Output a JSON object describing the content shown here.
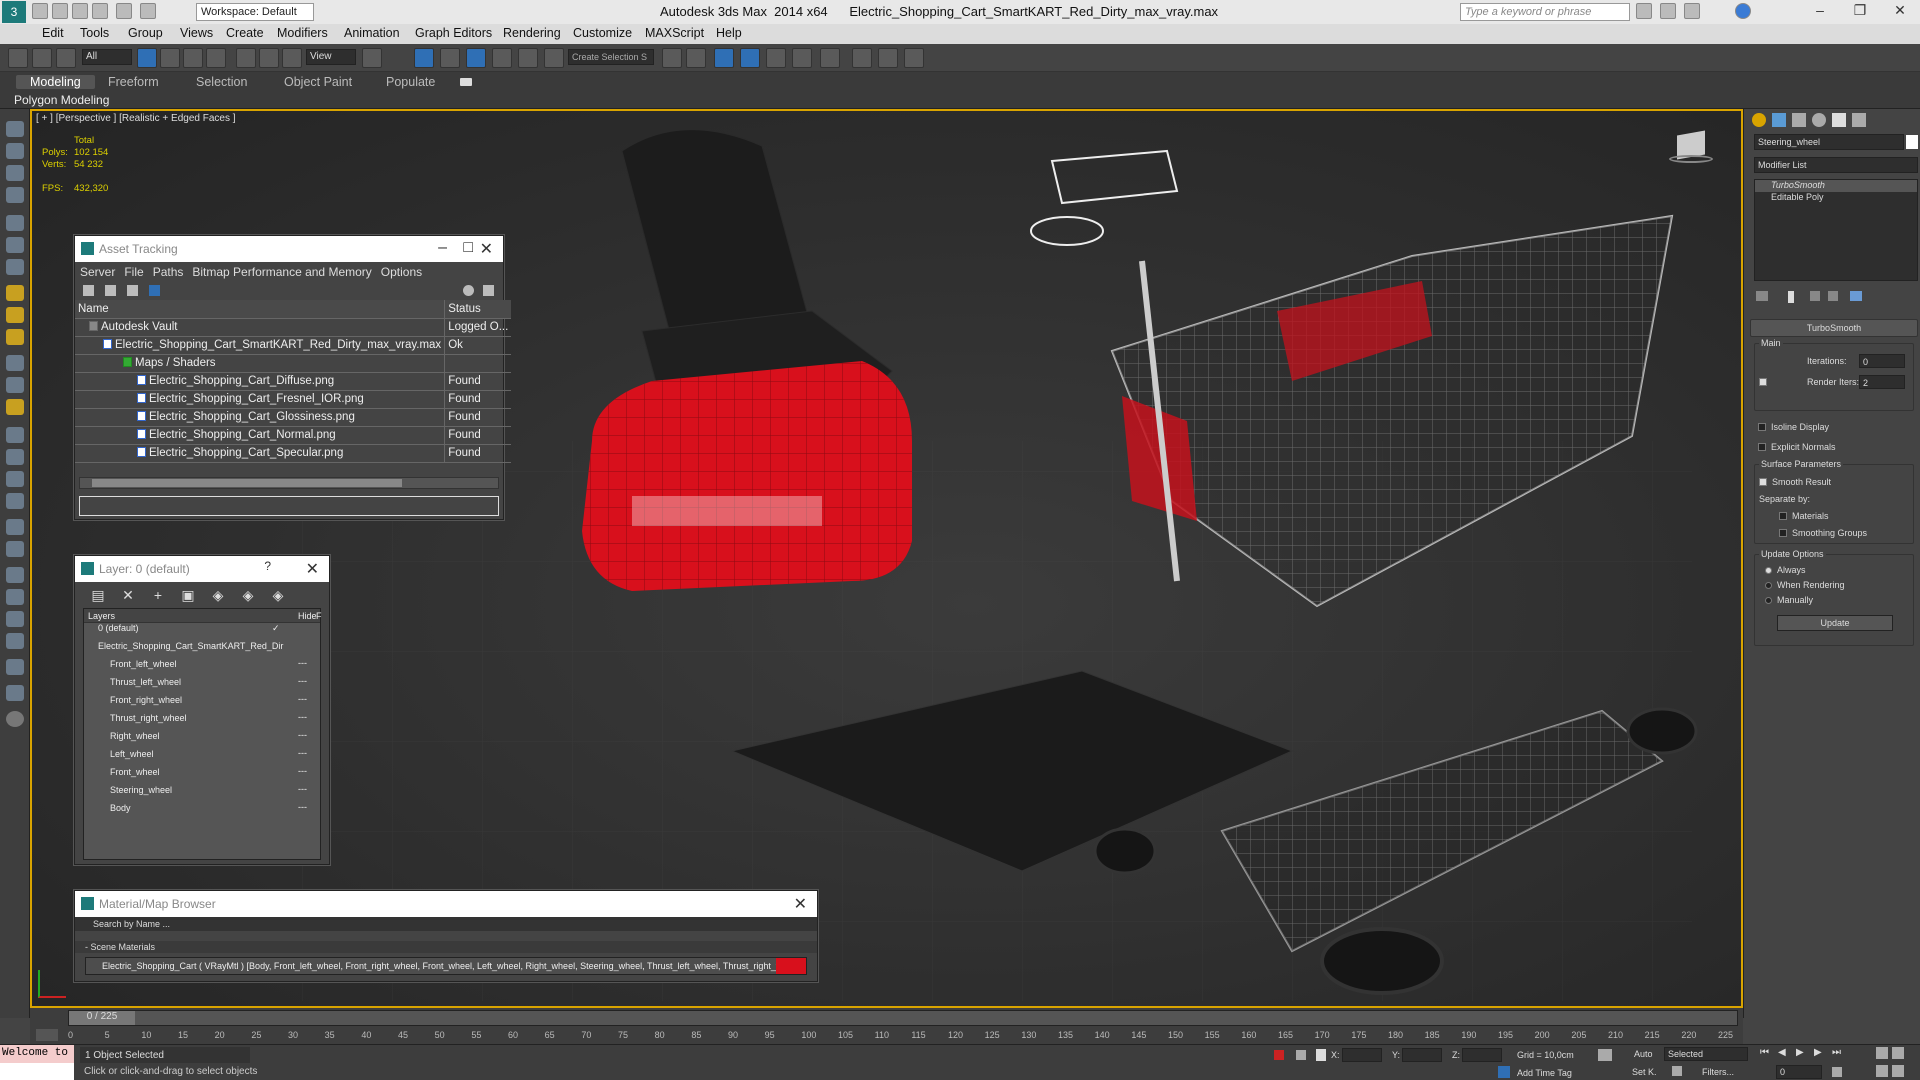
{
  "app": {
    "title": "Autodesk 3ds Max  2014 x64      Electric_Shopping_Cart_SmartKART_Red_Dirty_max_vray.max",
    "workspace": "Workspace: Default",
    "search_placeholder": "Type a keyword or phrase"
  },
  "menu": [
    "Edit",
    "Tools",
    "Group",
    "Views",
    "Create",
    "Modifiers",
    "Animation",
    "Graph Editors",
    "Rendering",
    "Customize",
    "MAXScript",
    "Help"
  ],
  "toolbar": {
    "selection_filter": "All",
    "view_mode": "View",
    "named_selection": "Create Selection S"
  },
  "ribbon": {
    "tabs": [
      "Modeling",
      "Freeform",
      "Selection",
      "Object Paint",
      "Populate"
    ],
    "subtab": "Polygon Modeling"
  },
  "viewport": {
    "label": "[ + ] [Perspective ] [Realistic + Edged Faces ]",
    "stats": {
      "total_label": "Total",
      "polys_label": "Polys:",
      "polys": "102 154",
      "verts_label": "Verts:",
      "verts": "54 232",
      "fps_label": "FPS:",
      "fps": "432,320"
    }
  },
  "asset_tracking": {
    "title": "Asset Tracking",
    "menu": [
      "Server",
      "File",
      "Paths",
      "Bitmap Performance and Memory",
      "Options"
    ],
    "columns": [
      "Name",
      "Status"
    ],
    "rows": [
      {
        "name": "Autodesk Vault",
        "status": "Logged O..."
      },
      {
        "name": "Electric_Shopping_Cart_SmartKART_Red_Dirty_max_vray.max",
        "status": "Ok"
      },
      {
        "name": "Maps / Shaders",
        "status": ""
      },
      {
        "name": "Electric_Shopping_Cart_Diffuse.png",
        "status": "Found"
      },
      {
        "name": "Electric_Shopping_Cart_Fresnel_IOR.png",
        "status": "Found"
      },
      {
        "name": "Electric_Shopping_Cart_Glossiness.png",
        "status": "Found"
      },
      {
        "name": "Electric_Shopping_Cart_Normal.png",
        "status": "Found"
      },
      {
        "name": "Electric_Shopping_Cart_Specular.png",
        "status": "Found"
      }
    ]
  },
  "layer": {
    "title": "Layer: 0 (default)",
    "help": "?",
    "columns": [
      "Layers",
      "Hide",
      "Fr"
    ],
    "items": [
      "0 (default)",
      "Electric_Shopping_Cart_SmartKART_Red_Dir",
      "Front_left_wheel",
      "Thrust_left_wheel",
      "Front_right_wheel",
      "Thrust_right_wheel",
      "Right_wheel",
      "Left_wheel",
      "Front_wheel",
      "Steering_wheel",
      "Body"
    ],
    "hide_mark": "---"
  },
  "material_browser": {
    "title": "Material/Map Browser",
    "search": "Search by Name ...",
    "section": "- Scene Materials",
    "item": "Electric_Shopping_Cart  ( VRayMtl ) [Body, Front_left_wheel, Front_right_wheel, Front_wheel, Left_wheel, Right_wheel, Steering_wheel, Thrust_left_wheel, Thrust_right_wheel]"
  },
  "command_panel": {
    "object_name": "Steering_wheel",
    "modifier_list": "Modifier List",
    "stack": [
      "TurboSmooth",
      "Editable Poly"
    ],
    "rollout": "TurboSmooth",
    "main": "Main",
    "iterations_label": "Iterations:",
    "iterations": "0",
    "render_iters_label": "Render Iters:",
    "render_iters": "2",
    "isoline": "Isoline Display",
    "explicit_normals": "Explicit Normals",
    "surface_params": "Surface Parameters",
    "smooth_result": "Smooth Result",
    "separate_by": "Separate by:",
    "materials": "Materials",
    "smoothing_groups": "Smoothing Groups",
    "update_options": "Update Options",
    "always": "Always",
    "when_rendering": "When Rendering",
    "manually": "Manually",
    "update_btn": "Update"
  },
  "timeline": {
    "frame": "0 / 225",
    "ticks": [
      "0",
      "5",
      "10",
      "15",
      "20",
      "25",
      "30",
      "35",
      "40",
      "45",
      "50",
      "55",
      "60",
      "65",
      "70",
      "75",
      "80",
      "85",
      "90",
      "95",
      "100",
      "105",
      "110",
      "115",
      "120",
      "125",
      "130",
      "135",
      "140",
      "145",
      "150",
      "155",
      "160",
      "165",
      "170",
      "175",
      "180",
      "185",
      "190",
      "195",
      "200",
      "205",
      "210",
      "215",
      "220",
      "225"
    ]
  },
  "status": {
    "listener": "Welcome to",
    "selected": "1 Object Selected",
    "prompt": "Click or click-and-drag to select objects",
    "x_label": "X:",
    "y_label": "Y:",
    "z_label": "Z:",
    "grid": "Grid = 10,0cm",
    "add_time_tag": "Add Time Tag",
    "auto": "Auto",
    "setk": "Set K.",
    "key_filter": "Selected",
    "filters": "Filters...",
    "frame_field": "0"
  },
  "colors": {
    "accent_blue": "#2f6fb5",
    "viewport_border": "#d9a400",
    "cart_red": "#d8101c",
    "stats_yellow": "#dcd000"
  }
}
